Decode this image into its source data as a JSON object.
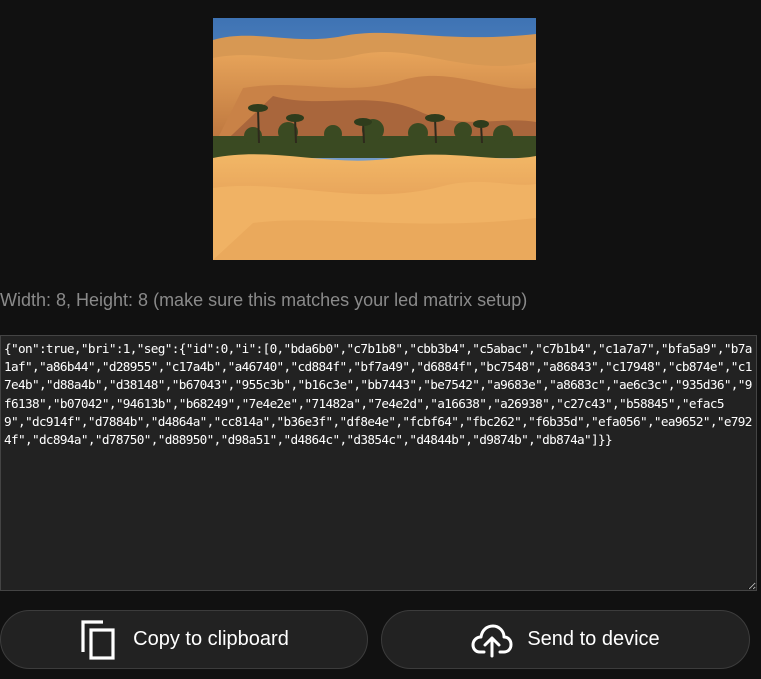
{
  "preview": {
    "alt": "Desert dunes with palm trees"
  },
  "dimensions": {
    "text": "Width: 8, Height: 8 (make sure this matches your led matrix setup)"
  },
  "json_output": {
    "value": "{\"on\":true,\"bri\":1,\"seg\":{\"id\":0,\"i\":[0,\"bda6b0\",\"c7b1b8\",\"cbb3b4\",\"c5abac\",\"c7b1b4\",\"c1a7a7\",\"bfa5a9\",\"b7a1af\",\"a86b44\",\"d28955\",\"c17a4b\",\"a46740\",\"cd884f\",\"bf7a49\",\"d6884f\",\"bc7548\",\"a86843\",\"c17948\",\"cb874e\",\"c17e4b\",\"d88a4b\",\"d38148\",\"b67043\",\"955c3b\",\"b16c3e\",\"bb7443\",\"be7542\",\"a9683e\",\"a8683c\",\"ae6c3c\",\"935d36\",\"9f6138\",\"b07042\",\"94613b\",\"b68249\",\"7e4e2e\",\"71482a\",\"7e4e2d\",\"a16638\",\"a26938\",\"c27c43\",\"b58845\",\"efac59\",\"dc914f\",\"d7884b\",\"d4864a\",\"cc814a\",\"b36e3f\",\"df8e4e\",\"fcbf64\",\"fbc262\",\"f6b35d\",\"efa056\",\"ea9652\",\"e7924f\",\"dc894a\",\"d78750\",\"d88950\",\"d98a51\",\"d4864c\",\"d3854c\",\"d4844b\",\"d9874b\",\"db874a\"]}}"
  },
  "buttons": {
    "copy_label": "Copy to clipboard",
    "send_label": "Send to device"
  },
  "icons": {
    "copy": "copy-icon",
    "send": "cloud-upload-icon"
  },
  "colors": {
    "background": "#111111",
    "panel": "#222222",
    "text": "#ffffff",
    "muted_text": "#8a8a8a"
  }
}
